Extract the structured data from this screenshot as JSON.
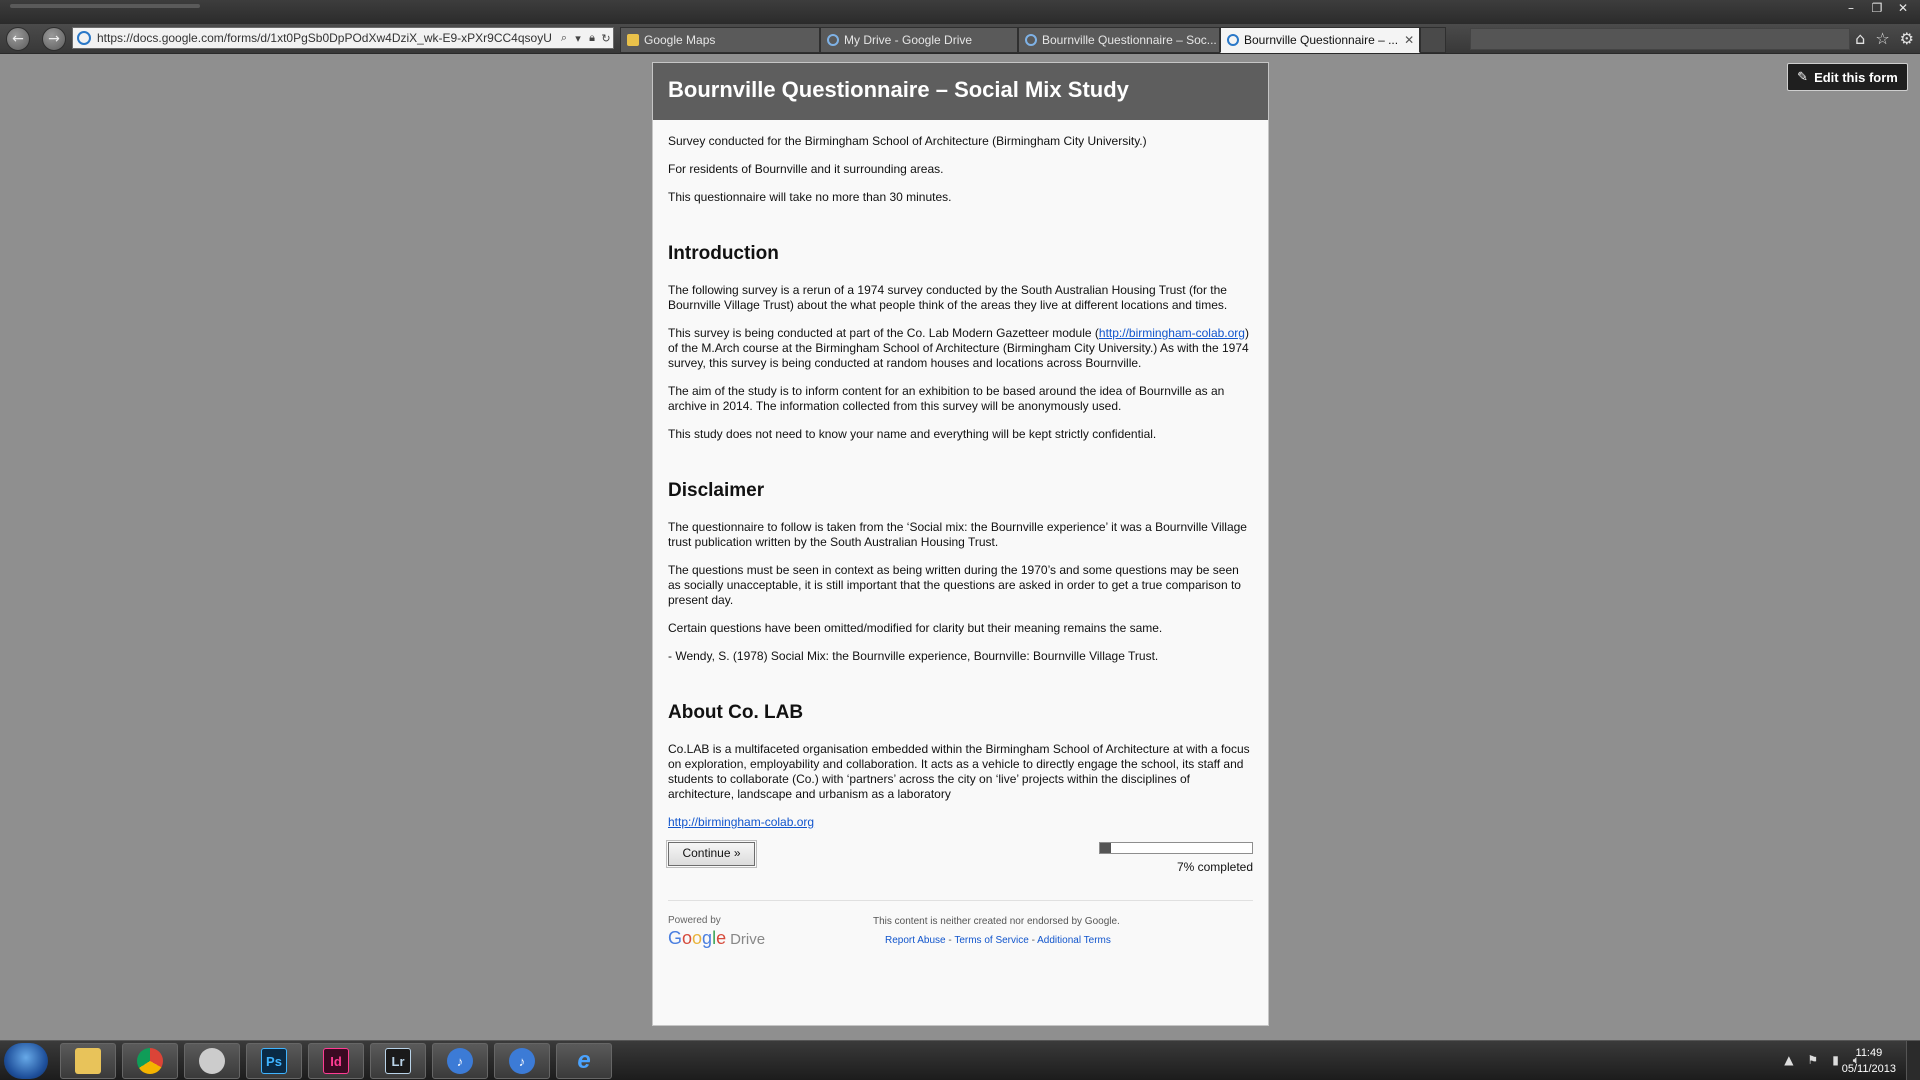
{
  "browser": {
    "url": "https://docs.google.com/forms/d/1xt0PgSb0DpPOdXw4DziX_wk-E9-xPXr9CC4qsoyU",
    "tabs": [
      {
        "label": "Google Maps",
        "active": false
      },
      {
        "label": "My Drive - Google Drive",
        "active": false
      },
      {
        "label": "Bournville Questionnaire – Soc...",
        "active": false
      },
      {
        "label": "Bournville Questionnaire – ...",
        "active": true
      }
    ],
    "tab_close": "✕"
  },
  "edit_button": {
    "label": "Edit this form"
  },
  "form": {
    "title": "Bournville Questionnaire – Social Mix Study",
    "intro_lines": [
      "Survey conducted for the Birmingham School of Architecture (Birmingham City University.)",
      "For residents of Bournville and it surrounding areas.",
      "This questionnaire will take no more than 30 minutes."
    ],
    "introduction": {
      "heading": "Introduction",
      "p1": "The following survey is a rerun of a 1974 survey conducted by the South Australian Housing Trust (for the Bournville Village Trust) about the what people think of the areas they live at different locations and times.",
      "p2_before": "This survey is being conducted at part of the Co. Lab Modern Gazetteer module (",
      "p2_link": "http://birmingham-colab.org",
      "p2_after": ") of the M.Arch course at the Birmingham School of Architecture (Birmingham City University.) As with the 1974 survey, this survey is being conducted at random houses and locations across Bournville.",
      "p3": "The aim of the study is to inform content for an exhibition to be based around the idea of Bournville as an archive in 2014. The information collected from this survey will be anonymously used.",
      "p4": "This study does not need to know your name and everything will be kept strictly confidential."
    },
    "disclaimer": {
      "heading": "Disclaimer",
      "p1": "The questionnaire to follow is taken from the ‘Social mix: the Bournville experience’ it was a Bournville Village trust publication written by the South Australian Housing Trust.",
      "p2": "The questions must be seen in context as being written during the 1970’s and some questions may be seen as socially unacceptable, it is still important that the questions are asked in order to get a true comparison to present day.",
      "p3": "Certain questions have been omitted/modified for clarity but their meaning remains the same.",
      "p4": "- Wendy, S. (1978) Social Mix: the Bournville experience, Bournville: Bournville Village Trust."
    },
    "about": {
      "heading": "About Co. LAB",
      "p1": "Co.LAB is a multifaceted organisation embedded within the Birmingham School of Architecture at with a focus on exploration, employability and collaboration. It acts as a vehicle to directly engage the school, its staff and students to collaborate (Co.) with ‘partners’ across the city on ‘live’ projects within the disciplines of architecture, landscape and urbanism as a laboratory",
      "link": "http://birmingham-colab.org"
    },
    "continue_label": "Continue »",
    "progress_fraction": 0.07,
    "progress_text": "7% completed"
  },
  "footer": {
    "powered_by": "Powered by",
    "google_letters": [
      "G",
      "o",
      "o",
      "g",
      "l",
      "e"
    ],
    "drive": "Drive",
    "note": "This content is neither created nor endorsed by Google.",
    "report_abuse": "Report Abuse",
    "terms": "Terms of Service",
    "additional": "Additional Terms",
    "sep": " - "
  },
  "taskbar": {
    "apps": [
      {
        "name": "file-explorer",
        "label": ""
      },
      {
        "name": "chrome",
        "label": ""
      },
      {
        "name": "tool",
        "label": ""
      },
      {
        "name": "photoshop",
        "label": "Ps"
      },
      {
        "name": "indesign",
        "label": "Id"
      },
      {
        "name": "lightroom",
        "label": "Lr"
      },
      {
        "name": "itunes-1",
        "label": "♪"
      },
      {
        "name": "itunes-2",
        "label": "♪"
      },
      {
        "name": "internet-explorer",
        "label": "e"
      }
    ],
    "time": "11:49",
    "date": "05/11/2013"
  },
  "colors": {
    "header_bg": "#5e5e5e",
    "link": "#1155cc",
    "progress_fill": "#555555"
  }
}
